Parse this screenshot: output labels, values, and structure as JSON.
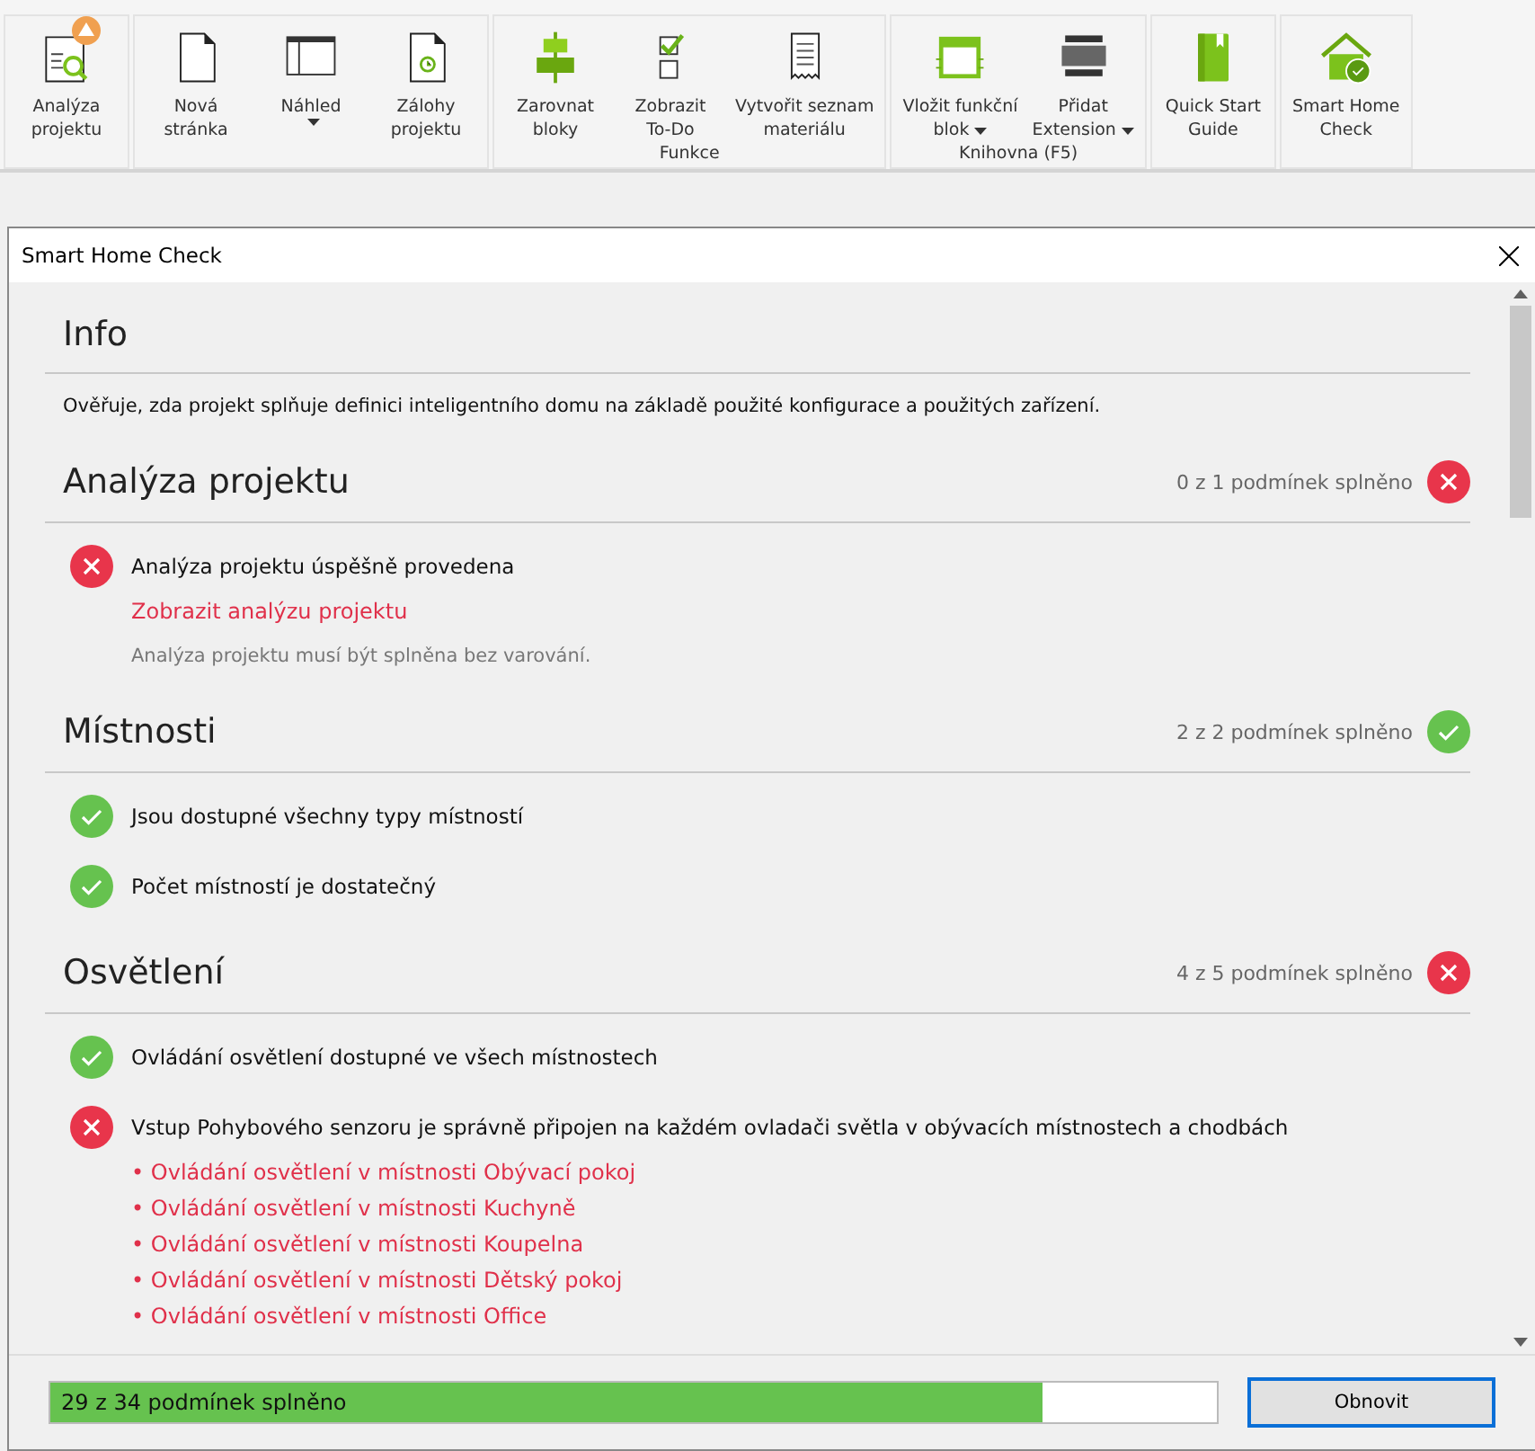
{
  "toolbar": {
    "groups": [
      {
        "buttons": [
          {
            "lines": [
              "Analýza",
              "projektu"
            ],
            "dropdown": false,
            "warning": true
          }
        ]
      },
      {
        "buttons": [
          {
            "lines": [
              "Nová",
              "stránka"
            ],
            "dropdown": false,
            "warning": false
          },
          {
            "lines": [
              "Náhled"
            ],
            "dropdown": true,
            "warning": false
          },
          {
            "lines": [
              "Zálohy",
              "projektu"
            ],
            "dropdown": false,
            "warning": false
          }
        ]
      },
      {
        "label": "Funkce",
        "buttons": [
          {
            "lines": [
              "Zarovnat",
              "bloky"
            ],
            "dropdown": false,
            "warning": false
          },
          {
            "lines": [
              "Zobrazit",
              "To-Do"
            ],
            "dropdown": false,
            "warning": false
          },
          {
            "lines": [
              "Vytvořit seznam",
              "materiálu"
            ],
            "dropdown": false,
            "warning": false
          }
        ]
      },
      {
        "label": "Knihovna (F5)",
        "buttons": [
          {
            "lines": [
              "Vložit funkční",
              "blok"
            ],
            "dropdown": true,
            "warning": false
          },
          {
            "lines": [
              "Přidat",
              "Extension"
            ],
            "dropdown": true,
            "warning": false
          }
        ]
      },
      {
        "buttons": [
          {
            "lines": [
              "Quick Start",
              "Guide"
            ],
            "dropdown": false,
            "warning": false
          }
        ]
      },
      {
        "buttons": [
          {
            "lines": [
              "Smart Home",
              "Check"
            ],
            "dropdown": false,
            "warning": false
          }
        ]
      }
    ]
  },
  "dialog": {
    "title": "Smart Home Check",
    "sections": [
      {
        "title": "Info",
        "description": "Ověřuje, zda projekt splňuje definici inteligentního domu na základě použité konfigurace a použitých zařízení."
      },
      {
        "title": "Analýza projektu",
        "summary": "0 z 1 podmínek splněno",
        "passed": false,
        "items": [
          {
            "text": "Analýza projektu úspěšně provedena",
            "passed": false,
            "link": "Zobrazit analýzu projektu",
            "note": "Analýza projektu musí být splněna bez varování."
          }
        ]
      },
      {
        "title": "Místnosti",
        "summary": "2 z 2 podmínek splněno",
        "passed": true,
        "items": [
          {
            "text": "Jsou dostupné všechny typy místností",
            "passed": true
          },
          {
            "text": "Počet místností je dostatečný",
            "passed": true
          }
        ]
      },
      {
        "title": "Osvětlení",
        "summary": "4 z 5 podmínek splněno",
        "passed": false,
        "items": [
          {
            "text": "Ovládání osvětlení dostupné ve všech místnostech",
            "passed": true
          },
          {
            "text": "Vstup Pohybového senzoru je správně připojen na každém ovladači světla v obývacích místnostech a chodbách",
            "passed": false,
            "bullets": [
              "• Ovládání osvětlení v místnosti Obývací pokoj",
              "• Ovládání osvětlení v místnosti Kuchyně",
              "• Ovládání osvětlení v místnosti Koupelna",
              "• Ovládání osvětlení v místnosti Dětský pokoj",
              "• Ovládání osvětlení v místnosti Office"
            ]
          }
        ]
      }
    ],
    "progress": {
      "text": "29 z 34 podmínek splněno",
      "level": 0.85
    },
    "button": "Obnovit"
  }
}
